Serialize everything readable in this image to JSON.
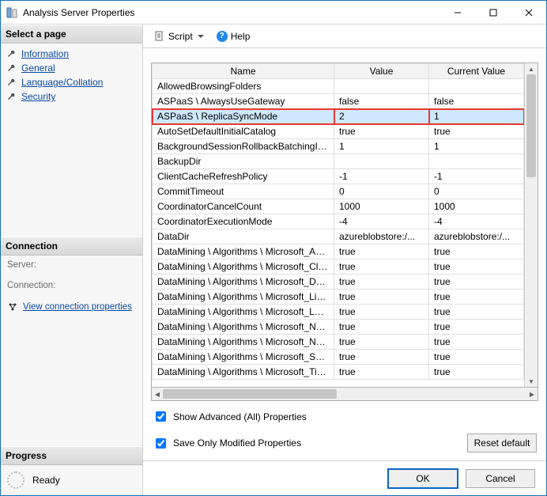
{
  "window": {
    "title": "Analysis Server Properties"
  },
  "left": {
    "select_page_header": "Select a page",
    "pages": [
      {
        "label": "Information"
      },
      {
        "label": "General"
      },
      {
        "label": "Language/Collation"
      },
      {
        "label": "Security"
      }
    ],
    "connection_header": "Connection",
    "server_label": "Server:",
    "connection_label": "Connection:",
    "view_conn": "View connection properties",
    "progress_header": "Progress",
    "progress_status": "Ready"
  },
  "toolbar": {
    "script": "Script",
    "help": "Help"
  },
  "grid": {
    "columns": {
      "name": "Name",
      "value": "Value",
      "current": "Current Value"
    },
    "rows": [
      {
        "name": "AllowedBrowsingFolders",
        "value": "",
        "current": ""
      },
      {
        "name": "ASPaaS \\ AlwaysUseGateway",
        "value": "false",
        "current": "false"
      },
      {
        "name": "ASPaaS \\ ReplicaSyncMode",
        "value": "2",
        "current": "1",
        "highlight": true
      },
      {
        "name": "AutoSetDefaultInitialCatalog",
        "value": "true",
        "current": "true"
      },
      {
        "name": "BackgroundSessionRollbackBatchingInterval",
        "value": "1",
        "current": "1"
      },
      {
        "name": "BackupDir",
        "value": "",
        "current": ""
      },
      {
        "name": "ClientCacheRefreshPolicy",
        "value": "-1",
        "current": "-1"
      },
      {
        "name": "CommitTimeout",
        "value": "0",
        "current": "0"
      },
      {
        "name": "CoordinatorCancelCount",
        "value": "1000",
        "current": "1000"
      },
      {
        "name": "CoordinatorExecutionMode",
        "value": "-4",
        "current": "-4"
      },
      {
        "name": "DataDir",
        "value": "azureblobstore:/...",
        "current": "azureblobstore:/..."
      },
      {
        "name": "DataMining \\ Algorithms \\ Microsoft_Associati...",
        "value": "true",
        "current": "true"
      },
      {
        "name": "DataMining \\ Algorithms \\ Microsoft_Clusterin...",
        "value": "true",
        "current": "true"
      },
      {
        "name": "DataMining \\ Algorithms \\ Microsoft_Decision...",
        "value": "true",
        "current": "true"
      },
      {
        "name": "DataMining \\ Algorithms \\ Microsoft_Linear_R...",
        "value": "true",
        "current": "true"
      },
      {
        "name": "DataMining \\ Algorithms \\ Microsoft_Logistic_...",
        "value": "true",
        "current": "true"
      },
      {
        "name": "DataMining \\ Algorithms \\ Microsoft_Naive_B...",
        "value": "true",
        "current": "true"
      },
      {
        "name": "DataMining \\ Algorithms \\ Microsoft_Neural_...",
        "value": "true",
        "current": "true"
      },
      {
        "name": "DataMining \\ Algorithms \\ Microsoft_Sequenc...",
        "value": "true",
        "current": "true"
      },
      {
        "name": "DataMining \\ Algorithms \\ Microsoft_Time_Se...",
        "value": "true",
        "current": "true"
      }
    ]
  },
  "checks": {
    "show_advanced": "Show Advanced (All) Properties",
    "save_only_modified": "Save Only Modified Properties",
    "reset": "Reset default"
  },
  "footer": {
    "ok": "OK",
    "cancel": "Cancel"
  }
}
